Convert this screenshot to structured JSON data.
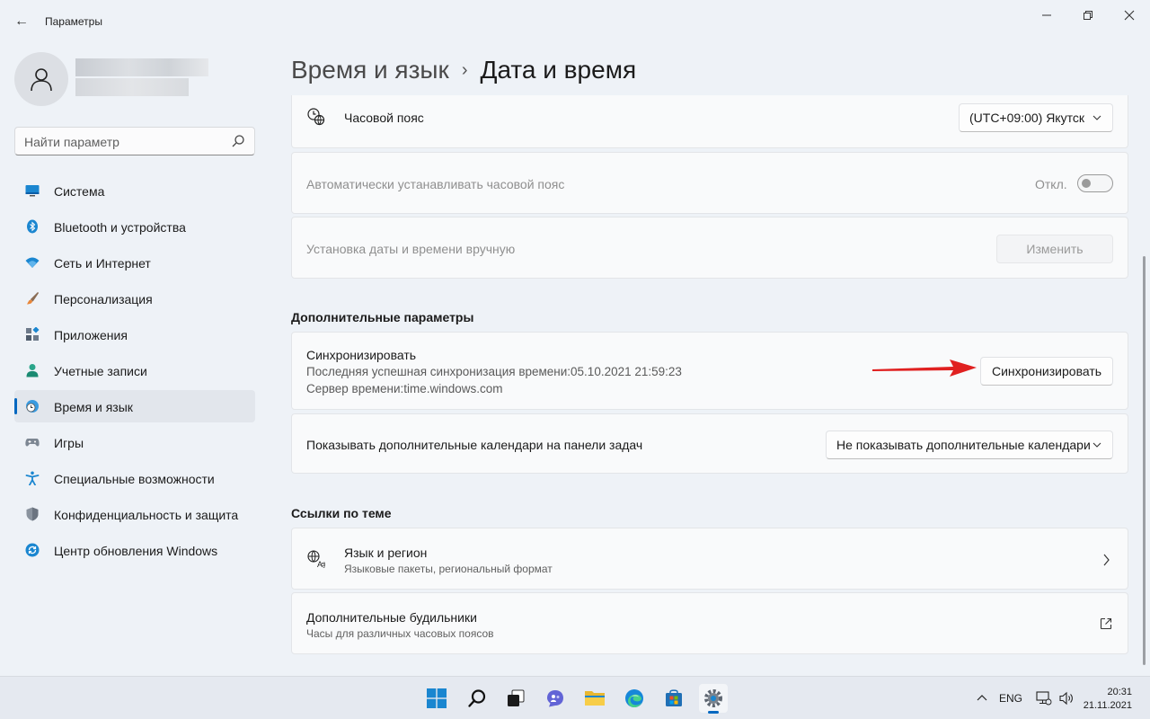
{
  "window": {
    "title": "Параметры",
    "back_glyph": "←",
    "min_glyph": "—",
    "max_glyph": "❐",
    "close_glyph": "✕"
  },
  "sidebar": {
    "search_placeholder": "Найти параметр",
    "items": [
      {
        "label": "Система",
        "icon": "system-icon",
        "active": false
      },
      {
        "label": "Bluetooth и устройства",
        "icon": "bluetooth-icon",
        "active": false
      },
      {
        "label": "Сеть и Интернет",
        "icon": "wifi-icon",
        "active": false
      },
      {
        "label": "Персонализация",
        "icon": "brush-icon",
        "active": false
      },
      {
        "label": "Приложения",
        "icon": "apps-icon",
        "active": false
      },
      {
        "label": "Учетные записи",
        "icon": "account-icon",
        "active": false
      },
      {
        "label": "Время и язык",
        "icon": "clock-globe-icon",
        "active": true
      },
      {
        "label": "Игры",
        "icon": "gamepad-icon",
        "active": false
      },
      {
        "label": "Специальные возможности",
        "icon": "accessibility-icon",
        "active": false
      },
      {
        "label": "Конфиденциальность и защита",
        "icon": "shield-icon",
        "active": false
      },
      {
        "label": "Центр обновления Windows",
        "icon": "update-icon",
        "active": false
      }
    ]
  },
  "header": {
    "parent": "Время и язык",
    "separator": "›",
    "current": "Дата и время"
  },
  "timezone": {
    "label": "Часовой пояс",
    "value": "(UTC+09:00) Якутск"
  },
  "auto_timezone": {
    "label": "Автоматически устанавливать часовой пояс",
    "state": "Откл."
  },
  "manual": {
    "label": "Установка даты и времени вручную",
    "button": "Изменить"
  },
  "additional": {
    "title": "Дополнительные параметры",
    "sync": {
      "title": "Синхронизировать",
      "last_sync": "Последняя успешная синхронизация времени:05.10.2021 21:59:23",
      "server": "Сервер времени:time.windows.com",
      "button": "Синхронизировать"
    },
    "calendars": {
      "label": "Показывать дополнительные календари на панели задач",
      "value": "Не показывать дополнительные календари"
    }
  },
  "related": {
    "title": "Ссылки по теме",
    "language": {
      "title": "Язык и регион",
      "subtitle": "Языковые пакеты, региональный формат"
    },
    "clocks": {
      "title": "Дополнительные будильники",
      "subtitle": "Часы для различных часовых поясов"
    }
  },
  "taskbar": {
    "language": "ENG",
    "time": "20:31",
    "date": "21.11.2021"
  },
  "colors": {
    "accent": "#0067c0",
    "arrow": "#e02020"
  }
}
